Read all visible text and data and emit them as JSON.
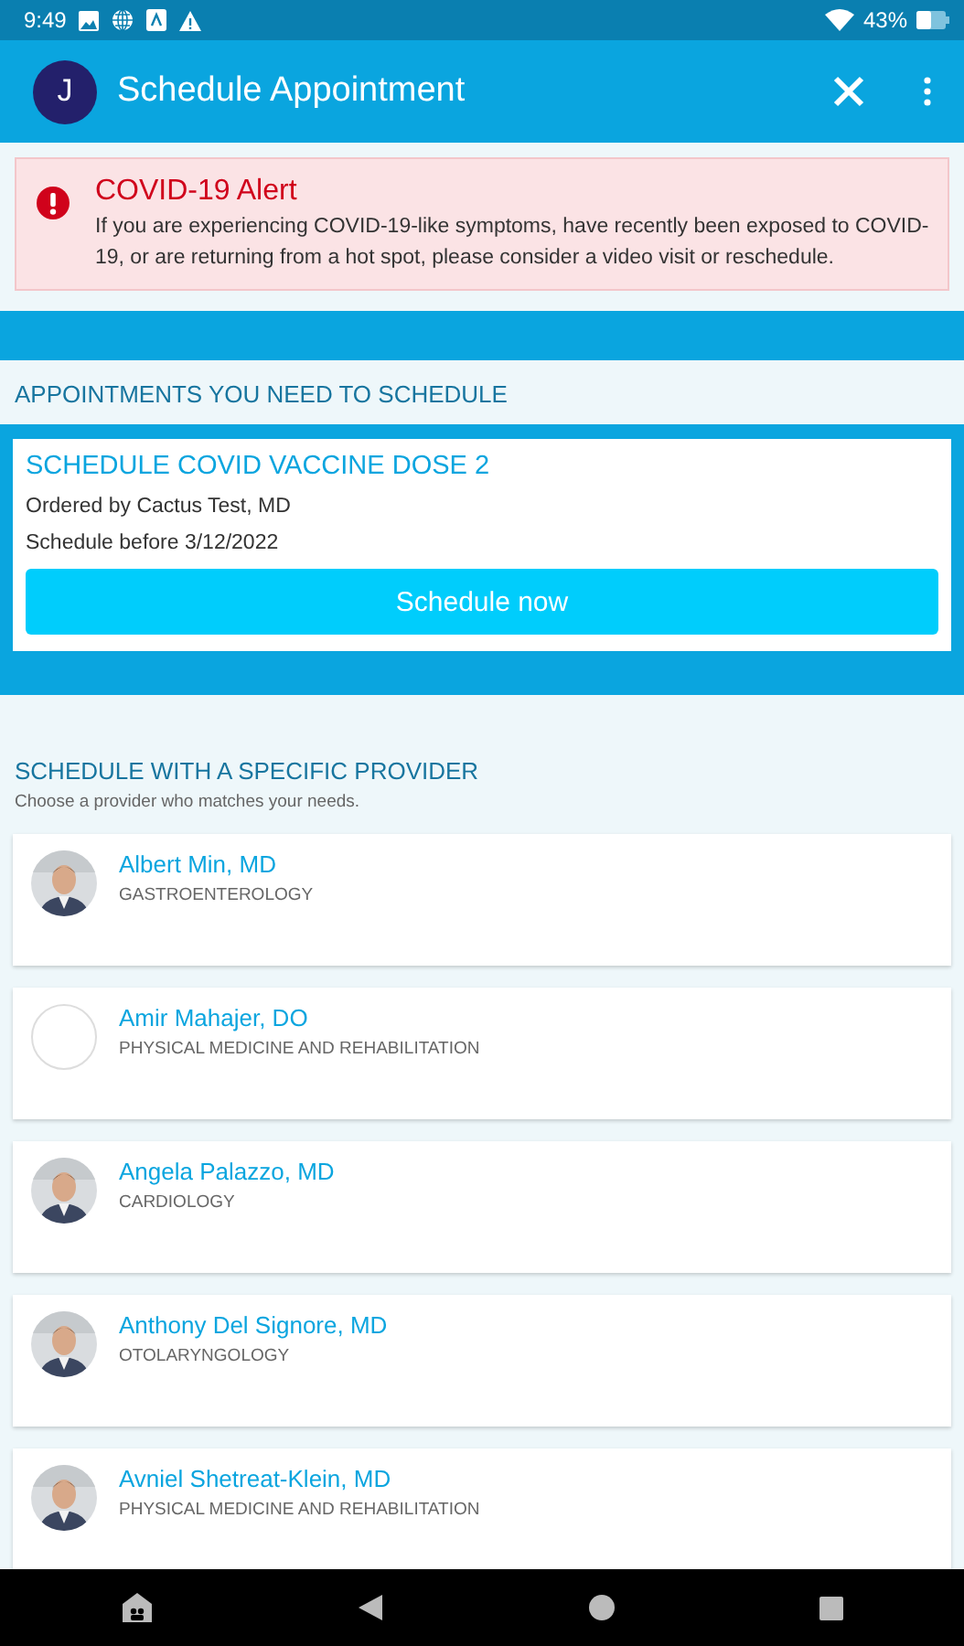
{
  "status_bar": {
    "time": "9:49",
    "battery": "43%"
  },
  "app_bar": {
    "avatar_letter": "J",
    "title": "Schedule Appointment"
  },
  "alert": {
    "title": "COVID-19 Alert",
    "message": "If you are experiencing COVID-19-like symptoms, have recently been exposed to COVID-19, or are returning from a hot spot, please consider a video visit or reschedule."
  },
  "appointments_section": {
    "heading": "APPOINTMENTS YOU NEED TO SCHEDULE",
    "items": [
      {
        "title": "SCHEDULE COVID VACCINE DOSE 2",
        "ordered_by": "Ordered by Cactus Test, MD",
        "deadline": "Schedule before 3/12/2022",
        "button": "Schedule now"
      }
    ]
  },
  "providers_section": {
    "heading": "SCHEDULE WITH A SPECIFIC PROVIDER",
    "subheading": "Choose a provider who matches your needs.",
    "providers": [
      {
        "name": "Albert Min, MD",
        "specialty": "GASTROENTEROLOGY",
        "kind": "picture"
      },
      {
        "name": "Amir Mahajer, DO",
        "specialty": "PHYSICAL MEDICINE AND REHABILITATION",
        "kind": "empty"
      },
      {
        "name": "Angela Palazzo, MD",
        "specialty": "CARDIOLOGY",
        "kind": "picture"
      },
      {
        "name": "Anthony Del Signore, MD",
        "specialty": "OTOLARYNGOLOGY",
        "kind": "picture"
      },
      {
        "name": "Avniel Shetreat-Klein, MD",
        "specialty": "PHYSICAL MEDICINE AND REHABILITATION",
        "kind": "picture"
      }
    ]
  }
}
